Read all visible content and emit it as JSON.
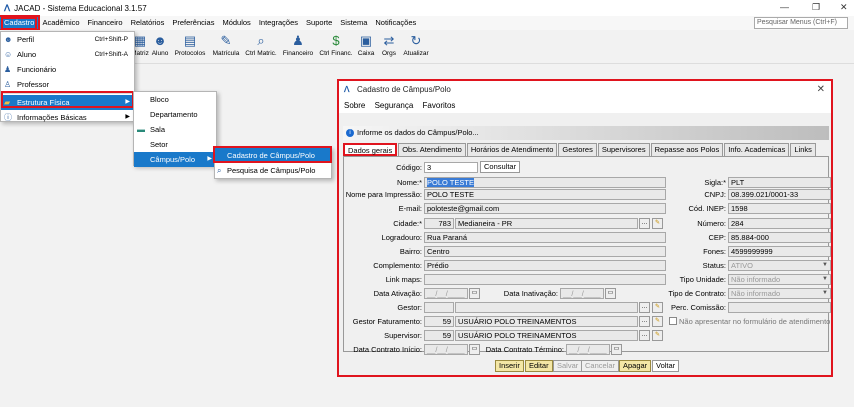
{
  "window": {
    "title": "JACAD - Sistema Educacional 3.1.57",
    "min": "—",
    "max": "❐",
    "close": "✕"
  },
  "menubar": {
    "items": [
      "Cadastro",
      "Acadêmico",
      "Financeiro",
      "Relatórios",
      "Preferências",
      "Módulos",
      "Integrações",
      "Suporte",
      "Sistema",
      "Notificações"
    ],
    "search_placeholder": "Pesquisar Menus (Ctrl+F)"
  },
  "toolbar": {
    "items": [
      "Matriz",
      "Aluno",
      "Protocolos",
      "Matrícula",
      "Ctrl Matric.",
      "Financeiro",
      "Ctrl Financ.",
      "Caixa",
      "Orgs",
      "Atualizar"
    ]
  },
  "cadastro_menu": {
    "items": [
      {
        "label": "Perfil",
        "shortcut": "Ctrl+Shift-P",
        "icon": "user-icon"
      },
      {
        "label": "Aluno",
        "shortcut": "Ctrl+Shift-A",
        "icon": "student-icon"
      },
      {
        "label": "Funcionário",
        "shortcut": "",
        "icon": "employee-icon"
      },
      {
        "label": "Professor",
        "shortcut": "",
        "icon": "teacher-icon"
      },
      {
        "label": "Estrutura Física",
        "shortcut": "",
        "icon": "folder-icon"
      },
      {
        "label": "Informações Básicas",
        "shortcut": "",
        "icon": "info-icon"
      }
    ]
  },
  "estrutura_menu": {
    "items": [
      "Bloco",
      "Departamento",
      "Sala",
      "Setor",
      "Câmpus/Polo"
    ]
  },
  "campus_menu": {
    "items": [
      "Cadastro de Câmpus/Polo",
      "Pesquisa de Câmpus/Polo"
    ]
  },
  "dialog": {
    "title": "Cadastro de Câmpus/Polo",
    "menu": [
      "Sobre",
      "Segurança",
      "Favoritos"
    ],
    "info": "Informe os dados do Câmpus/Polo...",
    "tabs": [
      "Dados gerais",
      "Obs. Atendimento",
      "Horários de Atendimento",
      "Gestores",
      "Supervisores",
      "Repasse aos Polos",
      "Info. Academicas",
      "Links"
    ],
    "labels": {
      "codigo": "Código:",
      "nome": "Nome:*",
      "nome_impressao": "Nome para Impressão:",
      "email": "E-mail:",
      "cidade": "Cidade:*",
      "logradouro": "Logradouro:",
      "bairro": "Bairro:",
      "complemento": "Complemento:",
      "link_maps": "Link maps:",
      "data_ativacao": "Data Ativação:",
      "data_inativacao": "Data Inativação:",
      "gestor": "Gestor:",
      "gestor_faturamento": "Gestor Faturamento:",
      "supervisor": "Supervisor:",
      "data_contrato_inicio": "Data Contrato Início:",
      "data_contrato_termino": "Data Contrato Término:",
      "sigla": "Sigla:*",
      "cnpj": "CNPJ:",
      "cod_inep": "Cód. INEP:",
      "numero": "Número:",
      "cep": "CEP:",
      "fones": "Fones:",
      "status": "Status:",
      "tipo_unidade": "Tipo Unidade:",
      "tipo_contrato": "Tipo de Contrato:",
      "perc_comissao": "Perc. Comissão:"
    },
    "values": {
      "codigo": "3",
      "consultar": "Consultar",
      "nome": "POLO TESTE",
      "nome_impressao": "POLO TESTE",
      "email": "poloteste@gmail.com",
      "cidade_cod": "783",
      "cidade": "Medianeira - PR",
      "logradouro": "Rua Paraná",
      "bairro": "Centro",
      "complemento": "Prédio",
      "date_mask": "__/__/____",
      "gestor_fat_cod": "59",
      "gestor_fat": "USUÁRIO POLO TREINAMENTOS",
      "supervisor_cod": "59",
      "supervisor": "USUÁRIO POLO TREINAMENTOS",
      "sigla": "PLT",
      "cnpj": "08.399.021/0001-33",
      "cod_inep": "1598",
      "numero": "284",
      "cep": "85.884-000",
      "fones": "4599999999",
      "status": "ATIVO",
      "tipo_unidade": "Não informado",
      "tipo_contrato": "Não informado",
      "nao_apresentar": "Não apresentar no formulário de atendimento"
    },
    "buttons": [
      "Inserir",
      "Editar",
      "Salvar",
      "Cancelar",
      "Apagar",
      "Voltar"
    ]
  },
  "colors": {
    "highlight": "#1979ca",
    "annotation": "#e0141e"
  }
}
